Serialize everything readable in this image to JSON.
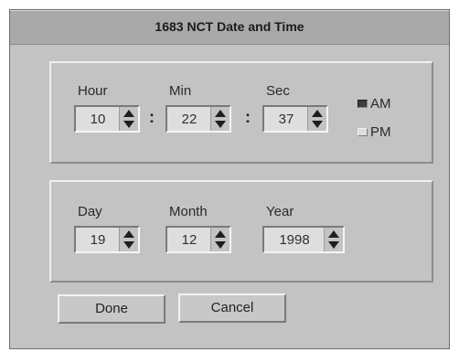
{
  "window": {
    "title": "1683 NCT Date and Time"
  },
  "time": {
    "hour_label": "Hour",
    "min_label": "Min",
    "sec_label": "Sec",
    "hour_value": "10",
    "min_value": "22",
    "sec_value": "37",
    "separator": ":",
    "am_label": "AM",
    "pm_label": "PM",
    "selected_period": "AM"
  },
  "date": {
    "day_label": "Day",
    "month_label": "Month",
    "year_label": "Year",
    "day_value": "19",
    "month_value": "12",
    "year_value": "1998"
  },
  "buttons": {
    "done_label": "Done",
    "cancel_label": "Cancel"
  },
  "icons": {
    "spin_up": "triangle-up-icon",
    "spin_down": "triangle-down-icon"
  }
}
